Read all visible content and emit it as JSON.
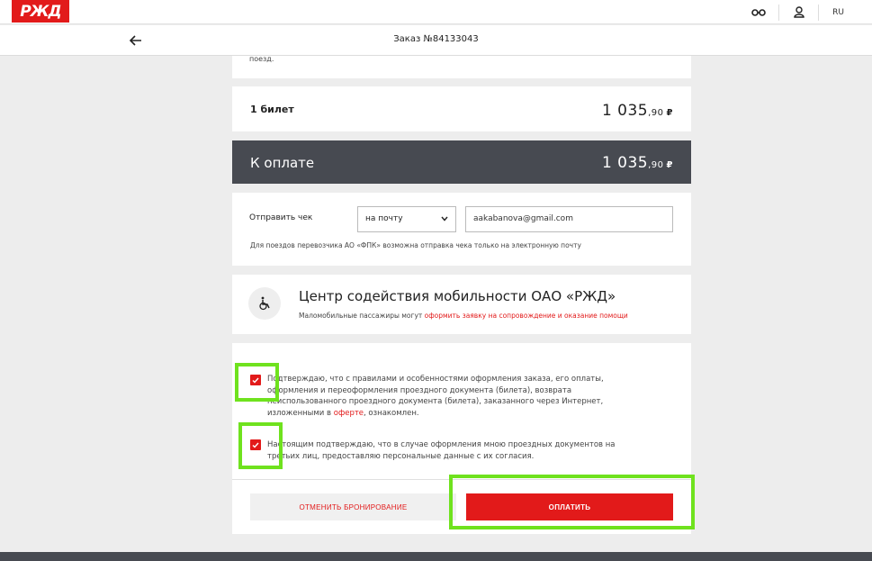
{
  "header": {
    "logo_text": "РЖД",
    "lang": "RU",
    "icons": [
      "glasses-icon",
      "user-icon"
    ]
  },
  "order": {
    "title": "Заказ №84133043"
  },
  "note": {
    "text": "поезд."
  },
  "tickets": {
    "label": "1 билет",
    "price_main": "1 035",
    "price_kop": ",90",
    "currency": "₽"
  },
  "payment": {
    "label": "К оплате",
    "price_main": "1 035",
    "price_kop": ",90",
    "currency": "₽"
  },
  "receipt": {
    "label": "Отправить чек",
    "method": "на почту",
    "email": "aakabanova@gmail.com",
    "note": "Для поездов перевозчика АО «ФПК» возможна отправка чека только на электронную почту"
  },
  "mobility": {
    "title": "Центр содействия мобильности ОАО «РЖД»",
    "subtitle_prefix": "Маломобильные пассажиры могут ",
    "subtitle_link": "оформить заявку на сопровождение и оказание помощи"
  },
  "agreements": {
    "first_text_1": "Подтверждаю, что с правилами и особенностями оформления заказа, его оплаты,",
    "first_text_2": "оформления и переоформления проездного документа (билета), возврата",
    "first_text_3": "неиспользованного проездного документа (билета), заказанного через Интернет,",
    "first_text_4_prefix": "изложенными в ",
    "first_link": "оферте",
    "first_text_4_suffix": ", ознакомлен.",
    "second_text_1": "Настоящим подтверждаю, что в случае оформления мною проездных документов на",
    "second_text_2": "третьих лиц, предоставляю персональные данные с их согласия.",
    "first_checked": true,
    "second_checked": true
  },
  "buttons": {
    "cancel": "ОТМЕНИТЬ БРОНИРОВАНИЕ",
    "pay": "ОПЛАТИТЬ"
  },
  "colors": {
    "brand_red": "#e21a1a",
    "dark_panel": "#474a51",
    "highlight_green": "#6fe21e"
  }
}
